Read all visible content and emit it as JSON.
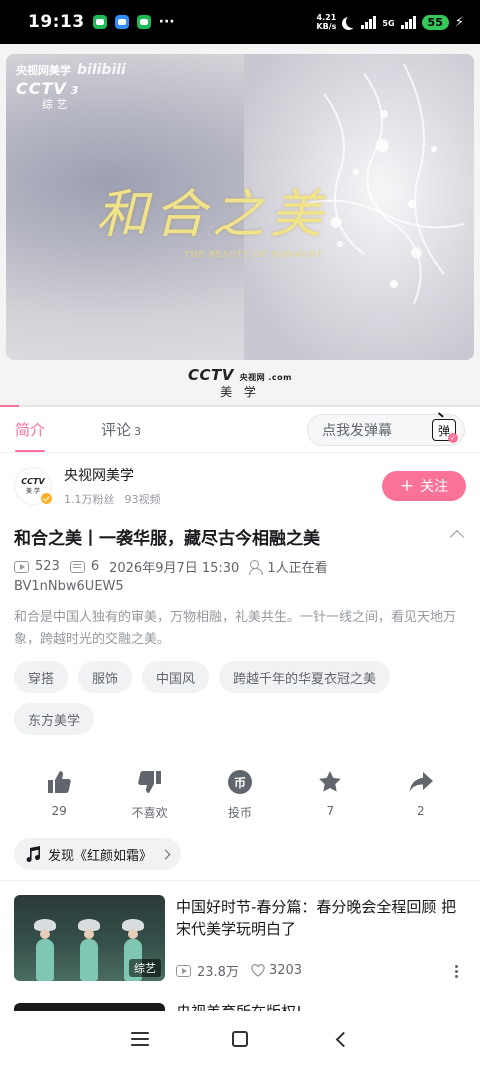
{
  "status_bar": {
    "time": "19:13",
    "net_speed_value": "4.21",
    "net_speed_unit": "KB/s",
    "network": "5G",
    "battery": "55",
    "more": "···"
  },
  "player": {
    "watermark_channel": "央视网美学",
    "watermark_site": "bilibili",
    "watermark_cctv": "CCTV",
    "watermark_number": "3",
    "watermark_sub": "综 艺",
    "title_cn": "和合之美",
    "title_en": "THE BEAUTY OF HARMONY",
    "footer_logo": "CCTV",
    "footer_logo_small": "央视网 .com",
    "footer_sub": "美 学",
    "progress": 0.04
  },
  "tabs": {
    "intro": "简介",
    "comments": "评论",
    "comments_count": "3",
    "danmaku_placeholder": "点我发弹幕",
    "danmaku_toggle": "弹"
  },
  "uploader": {
    "avatar_line1": "CCTV",
    "avatar_line2": "美 学",
    "name": "央视网美学",
    "fans": "1.1万粉丝",
    "videos": "93视频",
    "follow_label": "关注",
    "follow_plus": "+"
  },
  "video": {
    "title": "和合之美丨一袭华服，藏尽古今相融之美",
    "plays": "523",
    "danmaku_count": "6",
    "date": "2026年9月7日 15:30",
    "watching": "1人正在看",
    "bvid": "BV1nNbw6UEW5",
    "description": "和合是中国人独有的审美，万物相融，礼美共生。一针一线之间，看见天地万象，跨越时光的交融之美。"
  },
  "tags": [
    "穿搭",
    "服饰",
    "中国风",
    "跨越千年的华夏衣冠之美",
    "东方美学"
  ],
  "actions": [
    {
      "name": "like",
      "label": "29"
    },
    {
      "name": "dislike",
      "label": "不喜欢"
    },
    {
      "name": "coin",
      "label": "投币",
      "glyph": "币"
    },
    {
      "name": "favorite",
      "label": "7"
    },
    {
      "name": "share",
      "label": "2"
    }
  ],
  "music": {
    "label": "发现《红颜如霜》"
  },
  "recommendations": [
    {
      "title": "中国好时节-春分篇：春分晚会全程回顾 把宋代美学玩明白了",
      "badge": "综艺",
      "plays": "23.8万",
      "likes": "3203"
    },
    {
      "title": "央视美育所在版权!"
    }
  ],
  "colors": {
    "accent": "#fb7299",
    "text_primary": "#18191c",
    "text_secondary": "#61666d",
    "text_tertiary": "#9499a0",
    "title_gold": "#f1e38a"
  }
}
